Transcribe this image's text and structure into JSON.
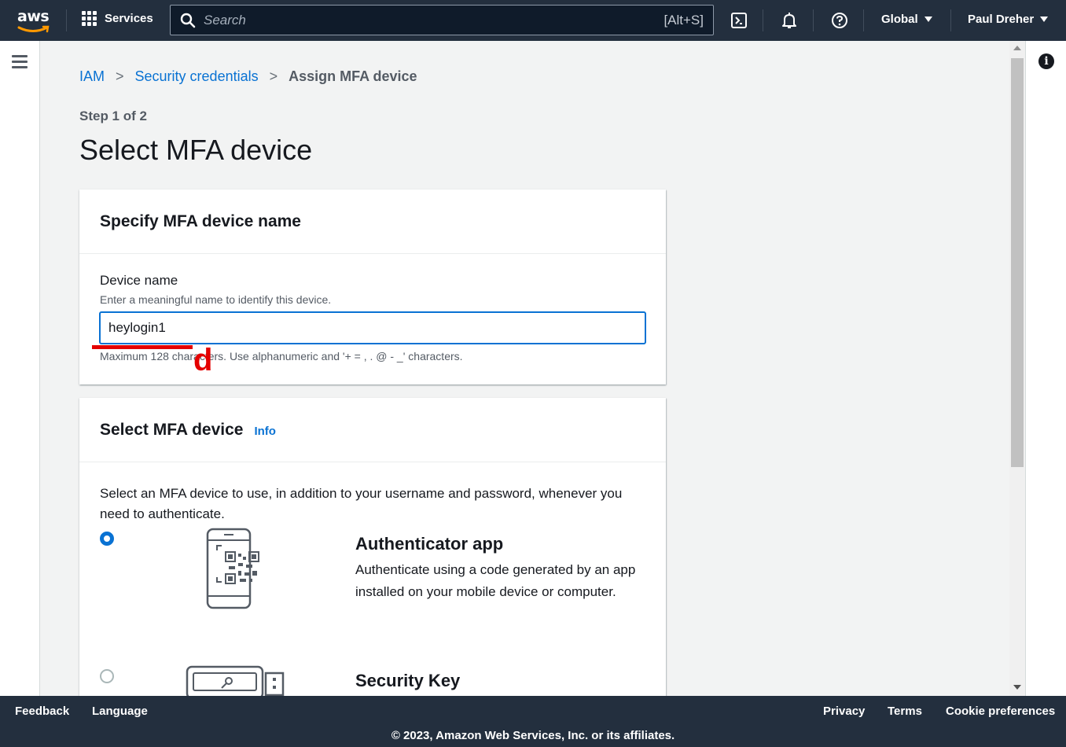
{
  "topnav": {
    "logo_text": "aws",
    "services_label": "Services",
    "search_placeholder": "Search",
    "search_shortcut": "[Alt+S]",
    "region_label": "Global",
    "user_label": "Paul Dreher"
  },
  "breadcrumb": {
    "items": [
      "IAM",
      "Security credentials"
    ],
    "current": "Assign MFA device"
  },
  "page": {
    "step_label": "Step 1 of 2",
    "title": "Select MFA device"
  },
  "device_name_card": {
    "header": "Specify MFA device name",
    "field_label": "Device name",
    "field_description": "Enter a meaningful name to identify this device.",
    "field_value": "heylogin1",
    "constraint_text": "Maximum 128 characters. Use alphanumeric and '+ = , . @ - _' characters."
  },
  "annotation": {
    "letter": "d",
    "color": "#e40000"
  },
  "mfa_card": {
    "header": "Select MFA device",
    "info_link": "Info",
    "description": "Select an MFA device to use, in addition to your username and password, whenever you need to authenticate.",
    "options": [
      {
        "title": "Authenticator app",
        "description": "Authenticate using a code generated by an app installed on your mobile device or computer.",
        "selected": true,
        "icon": "phone-qr-icon"
      },
      {
        "title": "Security Key",
        "description": "",
        "selected": false,
        "icon": "security-key-icon"
      }
    ]
  },
  "footer": {
    "feedback": "Feedback",
    "language": "Language",
    "privacy": "Privacy",
    "terms": "Terms",
    "cookie_preferences": "Cookie preferences",
    "copyright": "© 2023, Amazon Web Services, Inc. or its affiliates."
  },
  "colors": {
    "nav_bg": "#232f3e",
    "link": "#0972d3",
    "page_bg": "#f2f3f3"
  }
}
